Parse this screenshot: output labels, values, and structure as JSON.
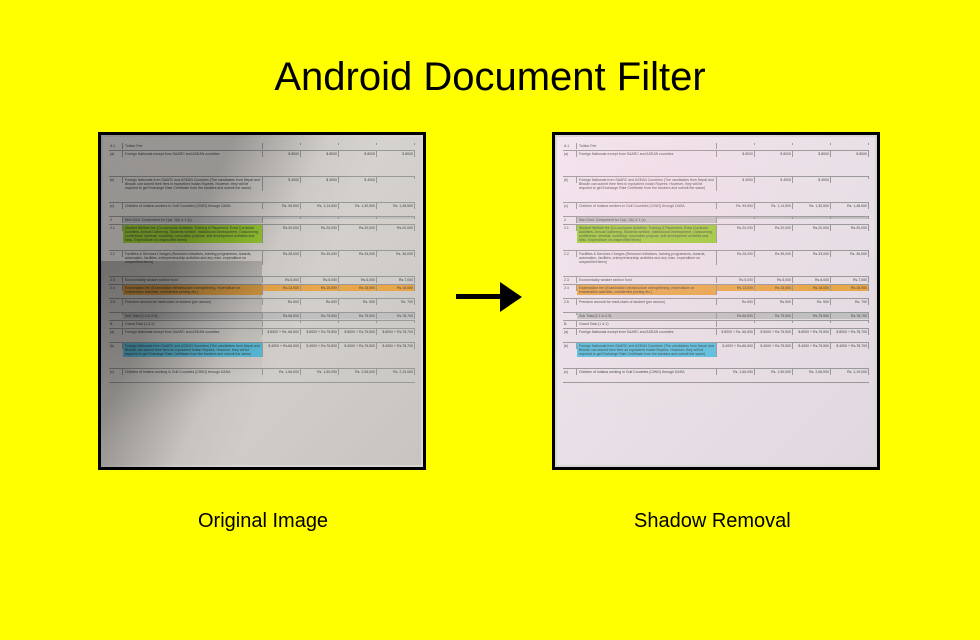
{
  "title": "Android Document Filter",
  "caption_left": "Original Image",
  "caption_right": "Shadow Removal",
  "doc": {
    "rows": [
      {
        "idx": "A.1",
        "desc": "Tuition Fee",
        "v": [
          "",
          "",
          "",
          ""
        ],
        "h": ""
      },
      {
        "idx": "(a)",
        "desc": "Foreign Nationals except from SAARC and ASEAN countries",
        "v": [
          "$ 8000",
          "$ 8000",
          "$ 8000",
          "$ 8000"
        ],
        "h": "",
        "tall": true
      },
      {
        "idx": "(b)",
        "desc": "Foreign Nationals from SAARC and ASEAN Countries (The candidates from Nepal and Bhutan can submit their fees in equivalent Indian Rupees. However, they will be required to get Exchange Rate Certificate from the bankers and submit the same)",
        "v": [
          "$ 4000",
          "$ 4000",
          "$ 4000",
          ""
        ],
        "h": "",
        "tall": true
      },
      {
        "idx": "(c)",
        "desc": "Children of Indians workers in Gulf Countries (CIWG) through DASA",
        "v": [
          "Rs. 99,500",
          "Rs. 1,14,500",
          "Rs. 1,30,500",
          "Rs. 1,48,500"
        ],
        "h": "",
        "med": true
      },
      {
        "idx": "2",
        "desc": "Non Govt. Component for 1(a), 1(b) & 1 (c)",
        "v": [
          "",
          "",
          "",
          ""
        ],
        "h": "grey"
      },
      {
        "idx": "2.1",
        "desc": "Student Welfare fee (Co-curricular Activities, Training & Placement, Extra Curricular Activities, Annual Gathering, Students welfare, Institutional Development, Outsourcing, conference, seminar, workshop, innovative projects, skill development activities and Misc. Expenditure on unspecified items)",
        "v": [
          "Rs.20,000",
          "Rs.20,000",
          "Rs.20,000",
          "Rs.20,000"
        ],
        "h": "green",
        "tall": true
      },
      {
        "idx": "2.2",
        "desc": "Facilities & Services Charges (Research initiatives, training programmes, Awards, automation, facilities, entrepreneurship activities and any misc. expenditure on unspecified items)",
        "v": [
          "Rs.28,000",
          "Rs.35,000",
          "Rs.33,000",
          "Rs. 36,000"
        ],
        "h": "",
        "tall": true
      },
      {
        "idx": "2.3",
        "desc": "Economically weaker section fund",
        "v": [
          "Rs.5,000",
          "Rs.5,000",
          "Rs.5,000",
          "Rs.7,000"
        ],
        "h": ""
      },
      {
        "idx": "2.4",
        "desc": "Examination fee (Examination Infrastructure strengthening, expenditure on examination activities, confidential printing etc.)",
        "v": [
          "Rs.13,000",
          "Rs.15,000",
          "Rs.15,000",
          "Rs.15,000"
        ],
        "h": "orange",
        "med": true
      },
      {
        "idx": "2.5",
        "desc": "Premium amount for medi-claim of student (per annum)",
        "v": [
          "Rs.500",
          "Rs.500",
          "Rs. 500",
          "Rs. 700"
        ],
        "h": "",
        "med": true
      },
      {
        "idx": "",
        "desc": "Sub Total (2.1 to 2.5)",
        "v": [
          "Rs.66,500",
          "Rs.75,500",
          "Rs.75,500",
          "Rs.78,700"
        ],
        "h": "grey"
      },
      {
        "idx": "B.",
        "desc": "Grand Total (1 & 2)",
        "v": [
          "",
          "",
          "",
          ""
        ],
        "h": ""
      },
      {
        "idx": "(a)",
        "desc": "Foreign Nationals except from SAARC and ASEAN countries",
        "v": [
          "$ 8000 + Rs. 66,500",
          "$ 8000 + Rs.75,500",
          "$ 8000 + Rs.75,500",
          "$ 8000 + Rs.78,700"
        ],
        "h": "",
        "med": true
      },
      {
        "idx": "(b)",
        "desc": "Foreign Nationals from SAARC and ASEAN Countries (The candidates from Nepal and Bhutan can submit their fees as equivalent Indian Rupees. However, they will be required to get Exchange Rate Certificate from the bankers and submit the same)",
        "v": [
          "$ 4000 + Rs.66,500",
          "$ 4000 + Rs.75,500",
          "$ 4000 + Rs.75,500",
          "$ 4000 + Rs.78,700"
        ],
        "h": "blue",
        "tall": true
      },
      {
        "idx": "(c)",
        "desc": "Children of Indians working in Gulf Countries (CIWG) through DASA",
        "v": [
          "Rs. 1,66,000",
          "Rs. 1,90,000",
          "Rs. 2,06,000",
          "Rs. 2,19,000"
        ],
        "h": "",
        "med": true
      }
    ]
  }
}
